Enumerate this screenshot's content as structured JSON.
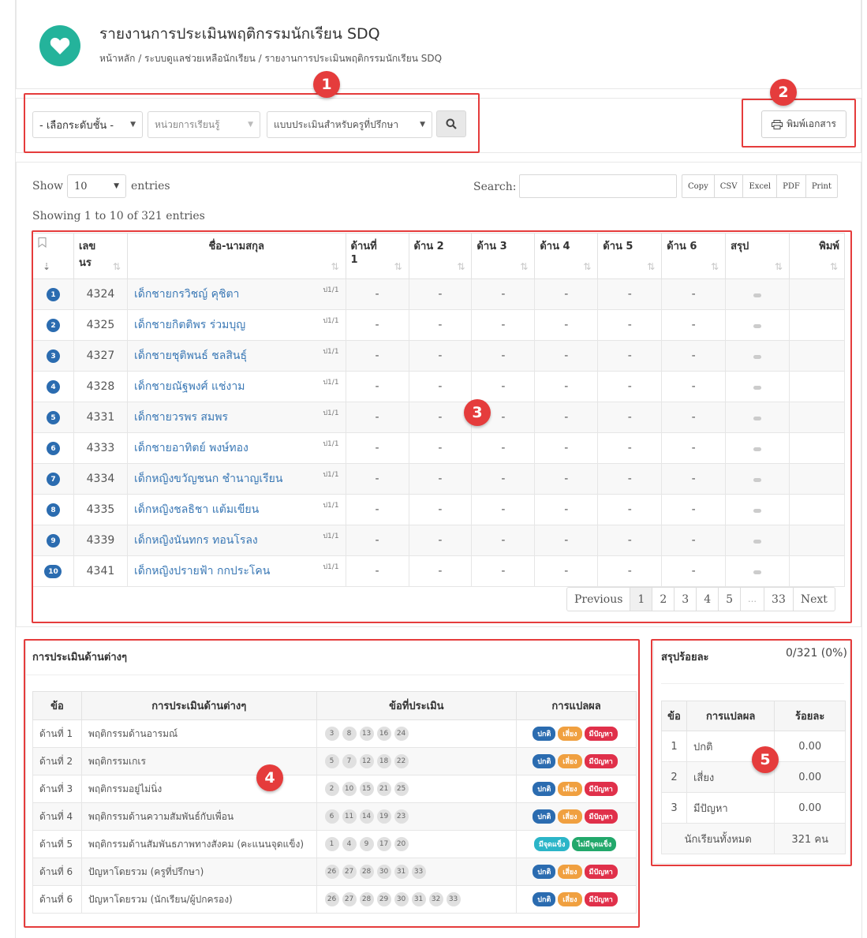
{
  "header": {
    "title": "รายงานการประเมินพฤติกรรมนักเรียน SDQ",
    "breadcrumb": "หน้าหลัก / ระบบดูแลช่วยเหลือนักเรียน / รายงานการประเมินพฤติกรรมนักเรียน SDQ",
    "icon": "heart-icon",
    "accent_color": "#24b39b"
  },
  "filters": {
    "level": "- เลือกระดับชั้น -",
    "unit": "หน่วยการเรียนรู้",
    "form": "แบบประเมินสำหรับครูที่ปรึกษา",
    "print_label": "พิมพ์เอกสาร"
  },
  "datatable": {
    "show_label": "Show",
    "entries_value": "10",
    "entries_label": "entries",
    "search_label": "Search:",
    "export_buttons": [
      "Copy",
      "CSV",
      "Excel",
      "PDF",
      "Print"
    ],
    "info": "Showing 1 to 10 of 321 entries",
    "columns": [
      "",
      "เลข นร",
      "ชื่อ-นามสกุล",
      "ด้านที่ 1",
      "ด้าน 2",
      "ด้าน 3",
      "ด้าน 4",
      "ด้าน 5",
      "ด้าน 6",
      "สรุป",
      "พิมพ์"
    ],
    "rows": [
      {
        "no": "1",
        "id": "4324",
        "name": "เด็กชายกรวิชญ์ คุชิตา",
        "cls": "ป1/1",
        "d": [
          "-",
          "-",
          "-",
          "-",
          "-",
          "-"
        ]
      },
      {
        "no": "2",
        "id": "4325",
        "name": "เด็กชายกิตติพร ร่วมบุญ",
        "cls": "ป1/1",
        "d": [
          "-",
          "-",
          "-",
          "-",
          "-",
          "-"
        ]
      },
      {
        "no": "3",
        "id": "4327",
        "name": "เด็กชายชุติพนธ์ ชลสินธุ์",
        "cls": "ป1/1",
        "d": [
          "-",
          "-",
          "-",
          "-",
          "-",
          "-"
        ]
      },
      {
        "no": "4",
        "id": "4328",
        "name": "เด็กชายณัฐพงศ์ แช่งาม",
        "cls": "ป1/1",
        "d": [
          "-",
          "-",
          "-",
          "-",
          "-",
          "-"
        ]
      },
      {
        "no": "5",
        "id": "4331",
        "name": "เด็กชายวรพร สมพร",
        "cls": "ป1/1",
        "d": [
          "-",
          "-",
          "-",
          "-",
          "-",
          "-"
        ]
      },
      {
        "no": "6",
        "id": "4333",
        "name": "เด็กชายอาทิตย์ พงษ์ทอง",
        "cls": "ป1/1",
        "d": [
          "-",
          "-",
          "-",
          "-",
          "-",
          "-"
        ]
      },
      {
        "no": "7",
        "id": "4334",
        "name": "เด็กหญิงขวัญชนก ชำนาญเรียน",
        "cls": "ป1/1",
        "d": [
          "-",
          "-",
          "-",
          "-",
          "-",
          "-"
        ]
      },
      {
        "no": "8",
        "id": "4335",
        "name": "เด็กหญิงชลธิชา แต้มเขียน",
        "cls": "ป1/1",
        "d": [
          "-",
          "-",
          "-",
          "-",
          "-",
          "-"
        ]
      },
      {
        "no": "9",
        "id": "4339",
        "name": "เด็กหญิงนันทกร ทอนโรลง",
        "cls": "ป1/1",
        "d": [
          "-",
          "-",
          "-",
          "-",
          "-",
          "-"
        ]
      },
      {
        "no": "10",
        "id": "4341",
        "name": "เด็กหญิงปรายฟ้า กกประโคน",
        "cls": "ป1/1",
        "d": [
          "-",
          "-",
          "-",
          "-",
          "-",
          "-"
        ]
      }
    ],
    "pagination": [
      "Previous",
      "1",
      "2",
      "3",
      "4",
      "5",
      "…",
      "33",
      "Next"
    ]
  },
  "evaluation": {
    "title": "การประเมินด้านต่างๆ",
    "columns": [
      "ข้อ",
      "การประเมินด้านต่างๆ",
      "ข้อที่ประเมิน",
      "การแปลผล"
    ],
    "rows": [
      {
        "side": "ด้านที่ 1",
        "name": "พฤติกรรมด้านอารมณ์",
        "items": [
          "3",
          "8",
          "13",
          "16",
          "24"
        ],
        "badges": [
          "ปกติ",
          "เสี่ยง",
          "มีปัญหา"
        ]
      },
      {
        "side": "ด้านที่ 2",
        "name": "พฤติกรรมเกเร",
        "items": [
          "5",
          "7",
          "12",
          "18",
          "22"
        ],
        "badges": [
          "ปกติ",
          "เสี่ยง",
          "มีปัญหา"
        ]
      },
      {
        "side": "ด้านที่ 3",
        "name": "พฤติกรรมอยู่ไม่นิ่ง",
        "items": [
          "2",
          "10",
          "15",
          "21",
          "25"
        ],
        "badges": [
          "ปกติ",
          "เสี่ยง",
          "มีปัญหา"
        ]
      },
      {
        "side": "ด้านที่ 4",
        "name": "พฤติกรรมด้านความสัมพันธ์กับเพื่อน",
        "items": [
          "6",
          "11",
          "14",
          "19",
          "23"
        ],
        "badges": [
          "ปกติ",
          "เสี่ยง",
          "มีปัญหา"
        ]
      },
      {
        "side": "ด้านที่ 5",
        "name": "พฤติกรรมด้านสัมพันธภาพทางสังคม (คะแนนจุดแข็ง)",
        "items": [
          "1",
          "4",
          "9",
          "17",
          "20"
        ],
        "badges": [
          "มีจุดแข็ง",
          "ไม่มีจุดแข็ง"
        ]
      },
      {
        "side": "ด้านที่ 6",
        "name": "ปัญหาโดยรวม (ครูที่ปรึกษา)",
        "items": [
          "26",
          "27",
          "28",
          "30",
          "31",
          "33"
        ],
        "badges": [
          "ปกติ",
          "เสี่ยง",
          "มีปัญหา"
        ]
      },
      {
        "side": "ด้านที่ 6",
        "name": "ปัญหาโดยรวม (นักเรียน/ผู้ปกครอง)",
        "items": [
          "26",
          "27",
          "28",
          "29",
          "30",
          "31",
          "32",
          "33"
        ],
        "badges": [
          "ปกติ",
          "เสี่ยง",
          "มีปัญหา"
        ]
      }
    ]
  },
  "summary": {
    "title": "สรุปร้อยละ",
    "total_ratio": "0/321 (0%)",
    "columns": [
      "ข้อ",
      "การแปลผล",
      "ร้อยละ"
    ],
    "rows": [
      {
        "no": "1",
        "label": "ปกติ",
        "pct": "0.00"
      },
      {
        "no": "2",
        "label": "เสี่ยง",
        "pct": "0.00"
      },
      {
        "no": "3",
        "label": "มีปัญหา",
        "pct": "0.00"
      }
    ],
    "total_label": "นักเรียนทั้งหมด",
    "total_value": "321 คน"
  },
  "annotations": [
    "1",
    "2",
    "3",
    "4",
    "5"
  ],
  "colors": {
    "annotation": "#e53c3c",
    "link": "#3a78b5",
    "badge_normal": "#2b6cb0",
    "badge_risk": "#f0a040",
    "badge_problem": "#e0304a"
  }
}
